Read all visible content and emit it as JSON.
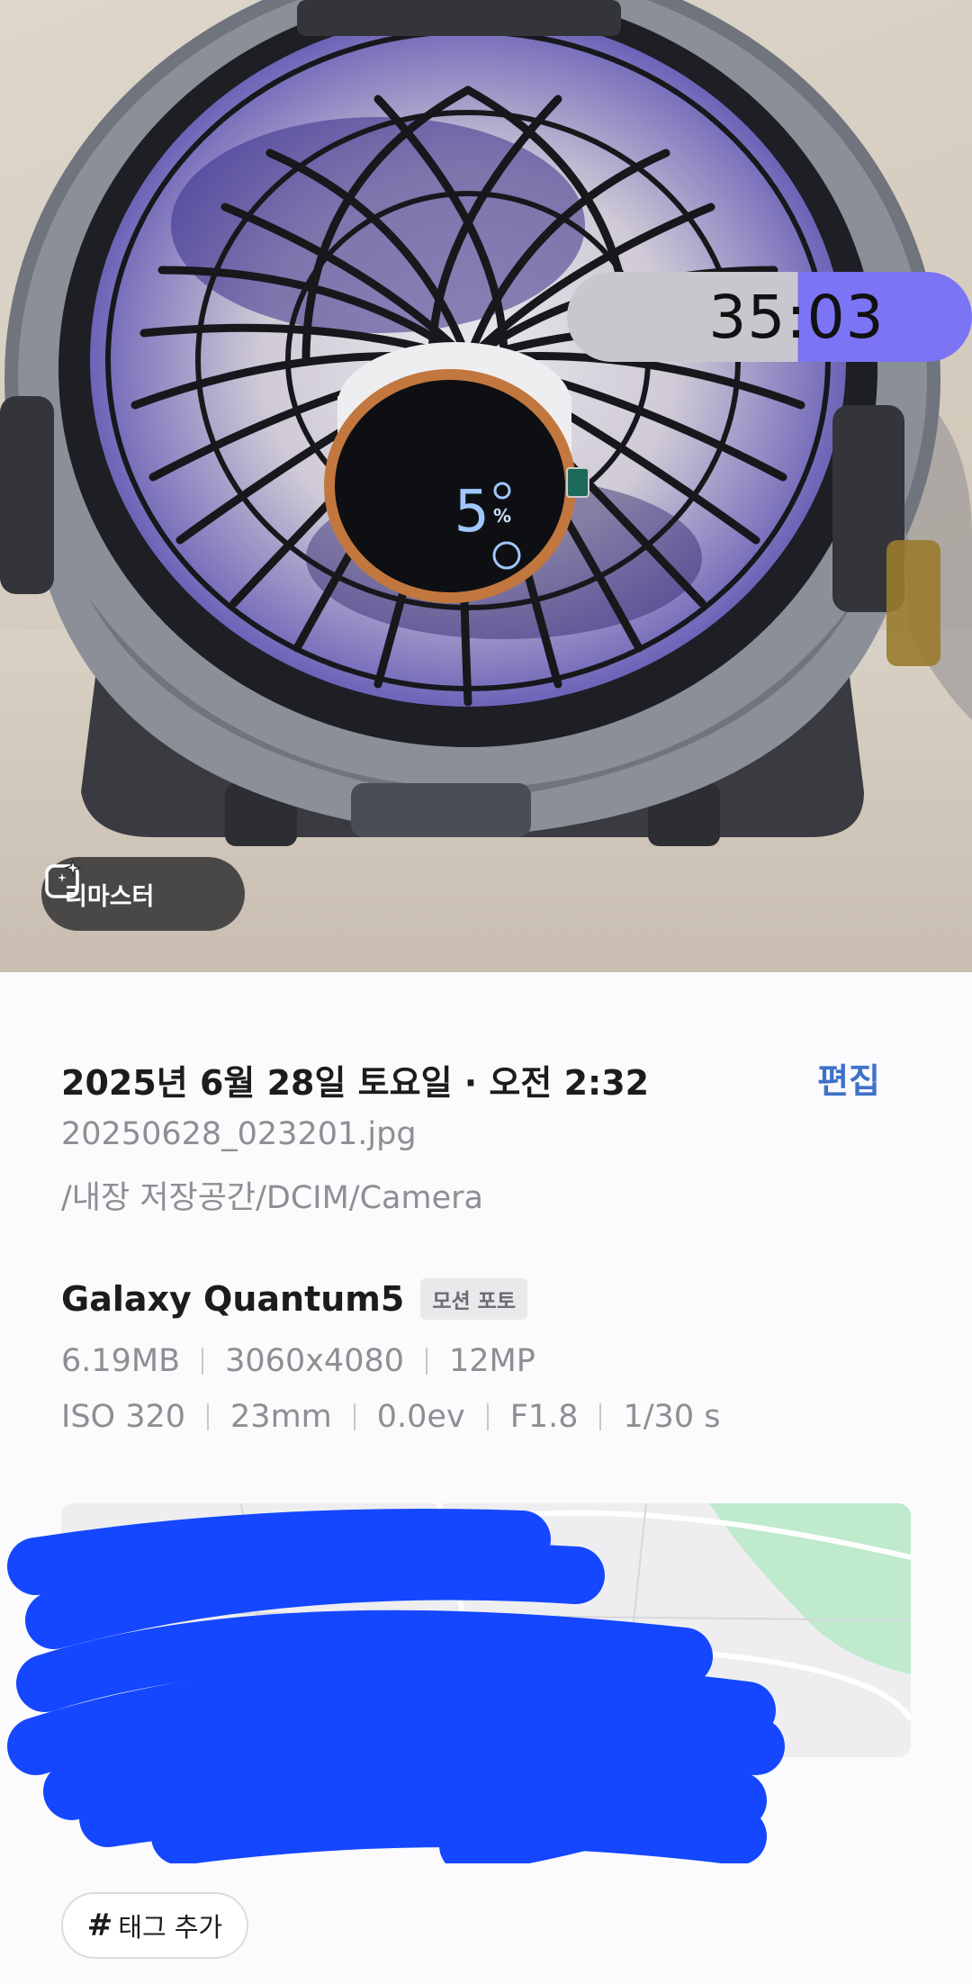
{
  "photo": {
    "timer": "35:03",
    "fan_display": {
      "level": "5",
      "unit": "%"
    }
  },
  "remaster": {
    "label": "리마스터",
    "icon": "sparkle-image-icon"
  },
  "details": {
    "date_time": "2025년 6월 28일 토요일 · 오전 2:32",
    "edit_label": "편집",
    "filename": "20250628_023201.jpg",
    "path": "/내장 저장공간/DCIM/Camera",
    "device": "Galaxy Quantum5",
    "badge": "모션 포토",
    "specs_row1": [
      "6.19MB",
      "3060x4080",
      "12MP"
    ],
    "specs_row2": [
      "ISO 320",
      "23mm",
      "0.0ev",
      "F1.8",
      "1/30 s"
    ]
  },
  "tag": {
    "hash": "#",
    "label": "태그 추가"
  },
  "colors": {
    "accent": "#3e72c9",
    "timer_progress": "#7b74f4",
    "redaction": "#1447ff",
    "map_park": "#bfeacc"
  }
}
